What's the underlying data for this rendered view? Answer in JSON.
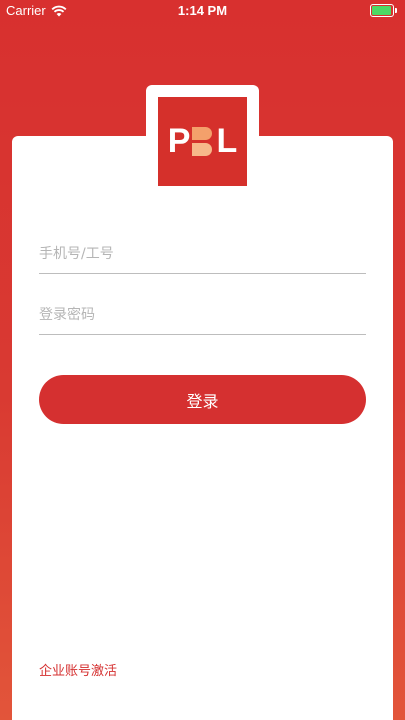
{
  "status_bar": {
    "carrier": "Carrier",
    "time": "1:14 PM",
    "battery_color": "#4cd964"
  },
  "logo": {
    "left_letter": "P",
    "right_letter": "L"
  },
  "form": {
    "phone_placeholder": "手机号/工号",
    "password_placeholder": "登录密码",
    "login_label": "登录"
  },
  "footer": {
    "activate_label": "企业账号激活"
  },
  "colors": {
    "brand_red": "#d53030",
    "logo_accent": "#f4a06b"
  }
}
